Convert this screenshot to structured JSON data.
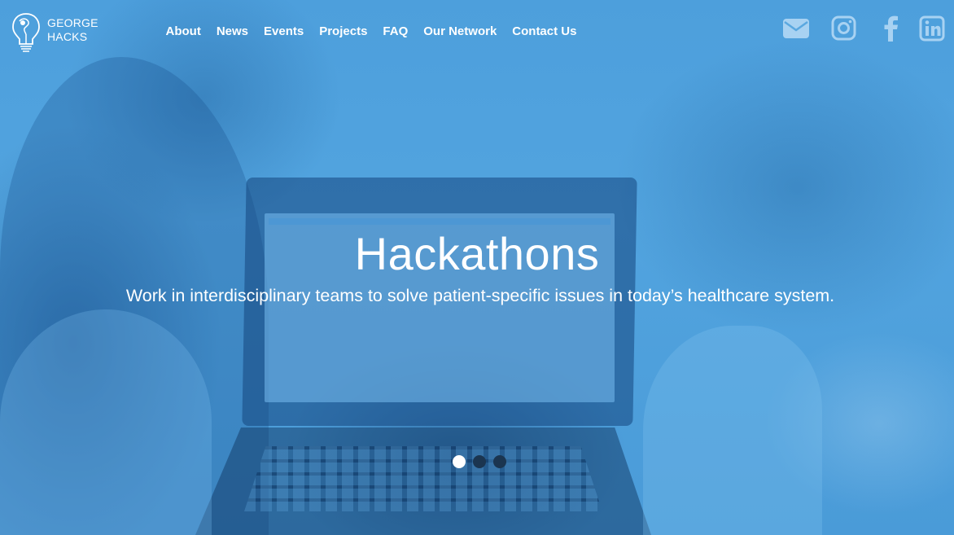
{
  "brand": {
    "line1": "GEORGE",
    "line2": "HACKS"
  },
  "nav": {
    "items": [
      {
        "label": "About"
      },
      {
        "label": "News"
      },
      {
        "label": "Events"
      },
      {
        "label": "Projects"
      },
      {
        "label": "FAQ"
      },
      {
        "label": "Our Network"
      },
      {
        "label": "Contact Us"
      }
    ]
  },
  "social": {
    "icons": [
      "envelope-icon",
      "instagram-icon",
      "facebook-icon",
      "linkedin-icon"
    ],
    "color": "#a8d2f2"
  },
  "hero": {
    "title": "Hackathons",
    "subtitle": "Work in interdisciplinary teams to solve patient-specific issues in today’s healthcare system.",
    "overlay_color": "#4c9fdc"
  },
  "carousel": {
    "slide_count": 3,
    "active_index": 0,
    "active_color": "#ffffff",
    "inactive_color": "#1b3550"
  }
}
